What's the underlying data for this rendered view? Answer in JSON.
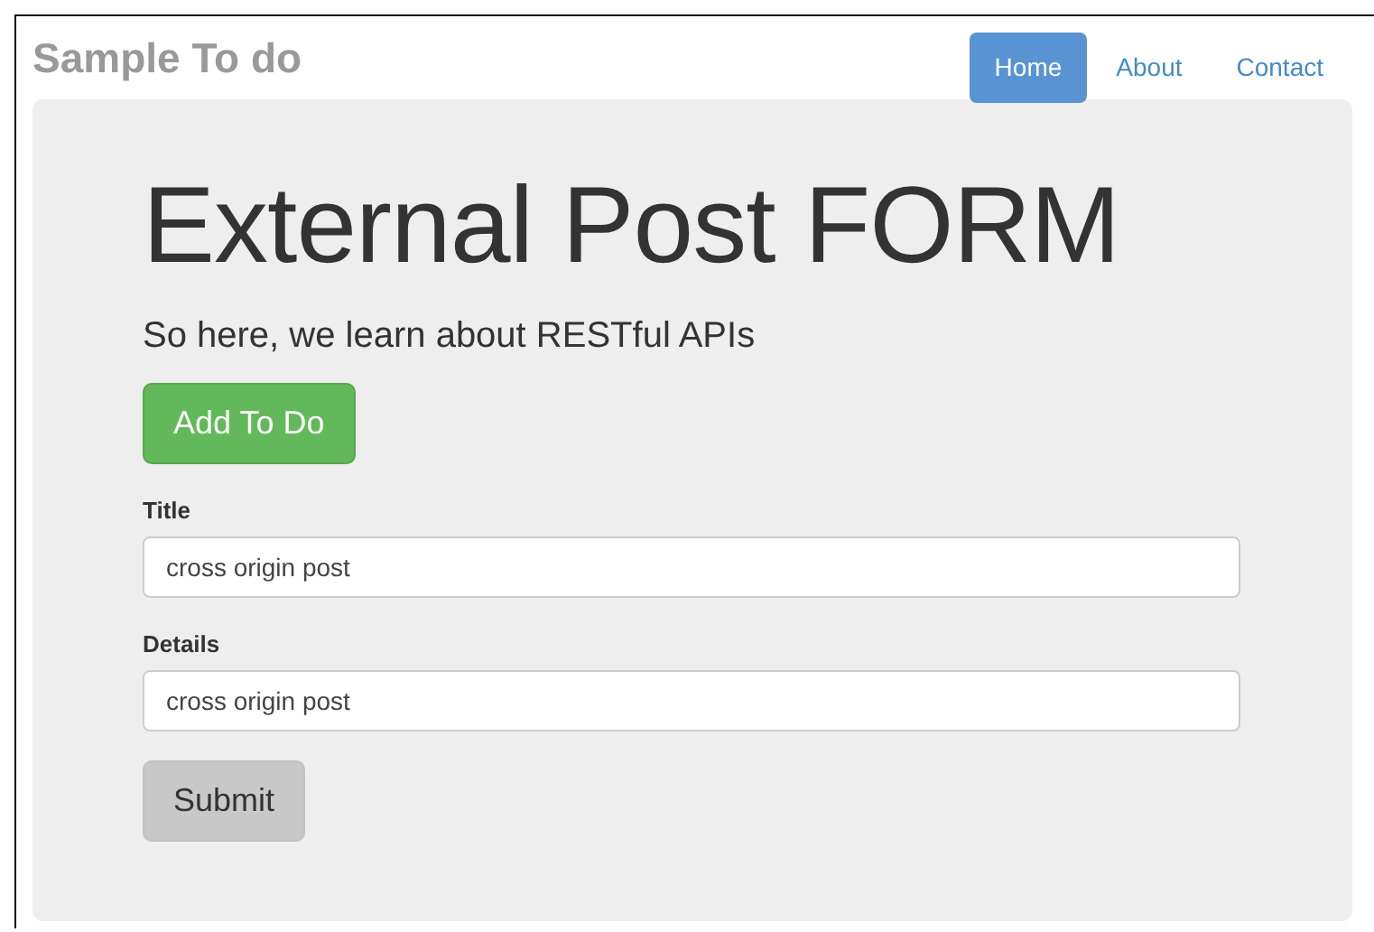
{
  "brand": "Sample To do",
  "nav": [
    {
      "label": "Home",
      "selected": true
    },
    {
      "label": "About",
      "selected": false
    },
    {
      "label": "Contact",
      "selected": false
    }
  ],
  "heading": "External Post FORM",
  "lead": "So here, we learn about RESTful APIs",
  "add_button": "Add To Do",
  "fields": [
    {
      "label": "Title",
      "value": "cross origin post"
    },
    {
      "label": "Details",
      "value": "cross origin post"
    }
  ],
  "submit_button": "Submit"
}
